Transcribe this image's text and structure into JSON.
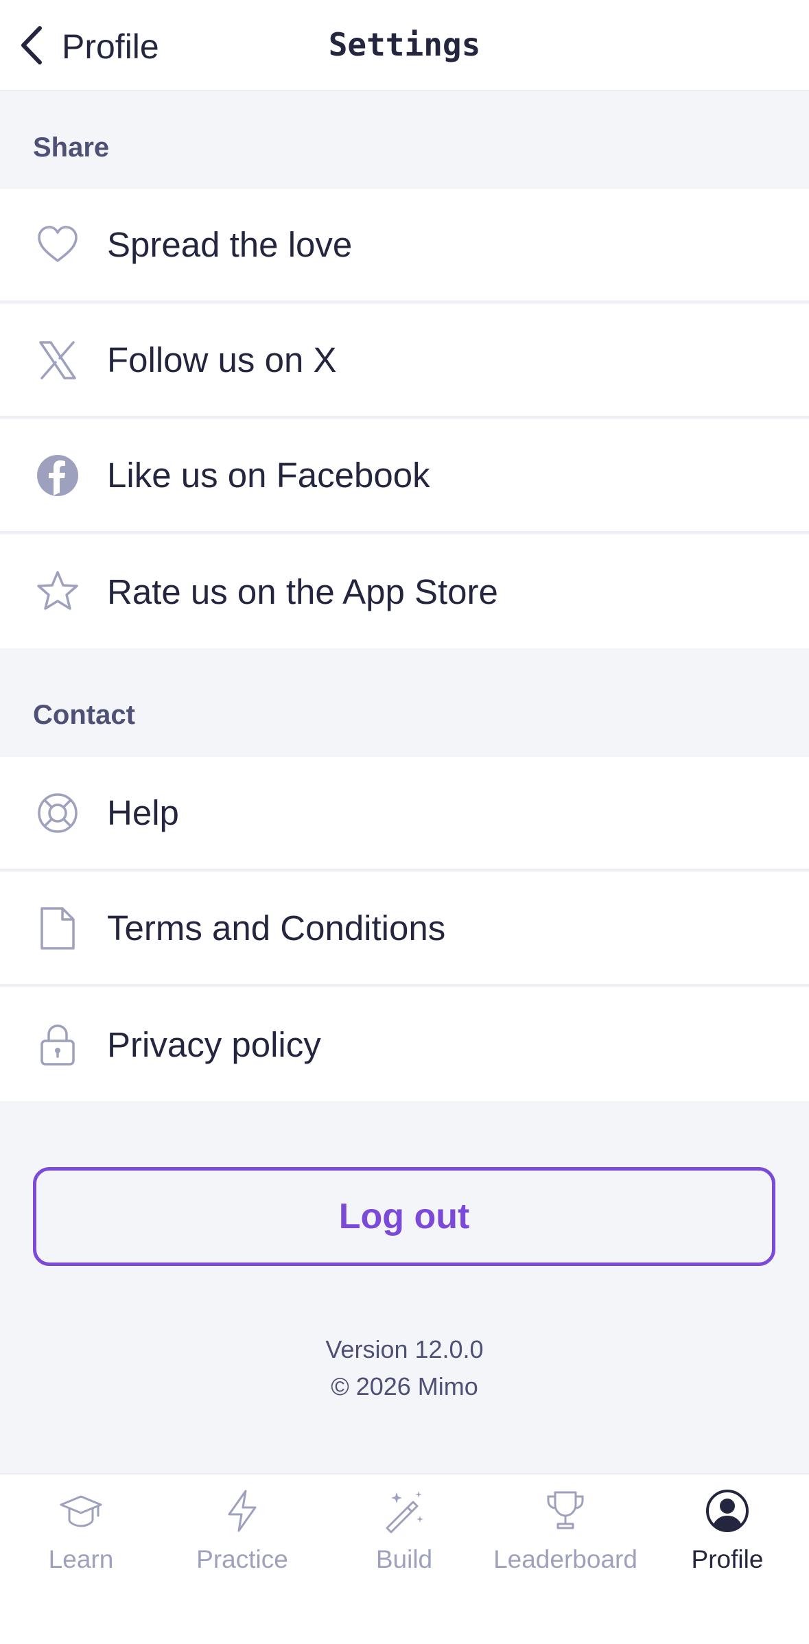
{
  "header": {
    "back_label": "Profile",
    "title": "Settings"
  },
  "sections": {
    "share": {
      "label": "Share",
      "items": [
        {
          "label": "Spread the love",
          "icon": "heart-icon"
        },
        {
          "label": "Follow us on X",
          "icon": "x-logo-icon"
        },
        {
          "label": "Like us on Facebook",
          "icon": "facebook-icon"
        },
        {
          "label": "Rate us on the App Store",
          "icon": "star-icon"
        }
      ]
    },
    "contact": {
      "label": "Contact",
      "items": [
        {
          "label": "Help",
          "icon": "lifebuoy-icon"
        },
        {
          "label": "Terms and Conditions",
          "icon": "document-icon"
        },
        {
          "label": "Privacy policy",
          "icon": "lock-icon"
        }
      ]
    }
  },
  "logout_label": "Log out",
  "footer": {
    "version": "Version 12.0.0",
    "copyright": "© 2026 Mimo"
  },
  "tabbar": {
    "tabs": [
      {
        "label": "Learn",
        "icon": "graduation-cap-icon",
        "active": false
      },
      {
        "label": "Practice",
        "icon": "lightning-icon",
        "active": false
      },
      {
        "label": "Build",
        "icon": "magic-wand-icon",
        "active": false
      },
      {
        "label": "Leaderboard",
        "icon": "trophy-icon",
        "active": false
      },
      {
        "label": "Profile",
        "icon": "user-circle-icon",
        "active": true
      }
    ]
  },
  "colors": {
    "accent": "#7c4ad8",
    "text": "#242640",
    "muted": "#9ea1bd",
    "background": "#f4f5f9"
  }
}
